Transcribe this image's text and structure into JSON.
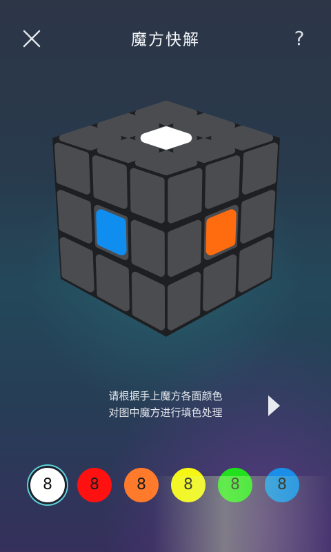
{
  "header": {
    "title": "魔方快解",
    "close_icon": "close-icon",
    "help_label": "?"
  },
  "cube": {
    "body_color": "#1e1f22",
    "tile_color": "#4b4c50",
    "center_colors": {
      "top": "#ffffff",
      "left": "#0f8ef0",
      "right": "#ff6c0f"
    }
  },
  "instruction": {
    "line1": "请根据手上魔方各面颜色",
    "line2": "对图中魔方进行填色处理"
  },
  "next_icon": "play-arrow-icon",
  "palette": {
    "selected_index": 0,
    "swatches": [
      {
        "name": "white",
        "color": "#ffffff",
        "text_color": "#111111",
        "count": "8"
      },
      {
        "name": "red",
        "color": "#ff1111",
        "text_color": "#1a1a1a",
        "count": "8"
      },
      {
        "name": "orange",
        "color": "#ff7a2a",
        "text_color": "#1a1a1a",
        "count": "8"
      },
      {
        "name": "yellow",
        "color": "#f6f615",
        "text_color": "#1a1a1a",
        "count": "8"
      },
      {
        "name": "green",
        "color": "#22e01e",
        "text_color": "#1a1a1a",
        "count": "8"
      },
      {
        "name": "blue",
        "color": "#1b8fe8",
        "text_color": "#1a1a1a",
        "count": "8"
      }
    ]
  }
}
